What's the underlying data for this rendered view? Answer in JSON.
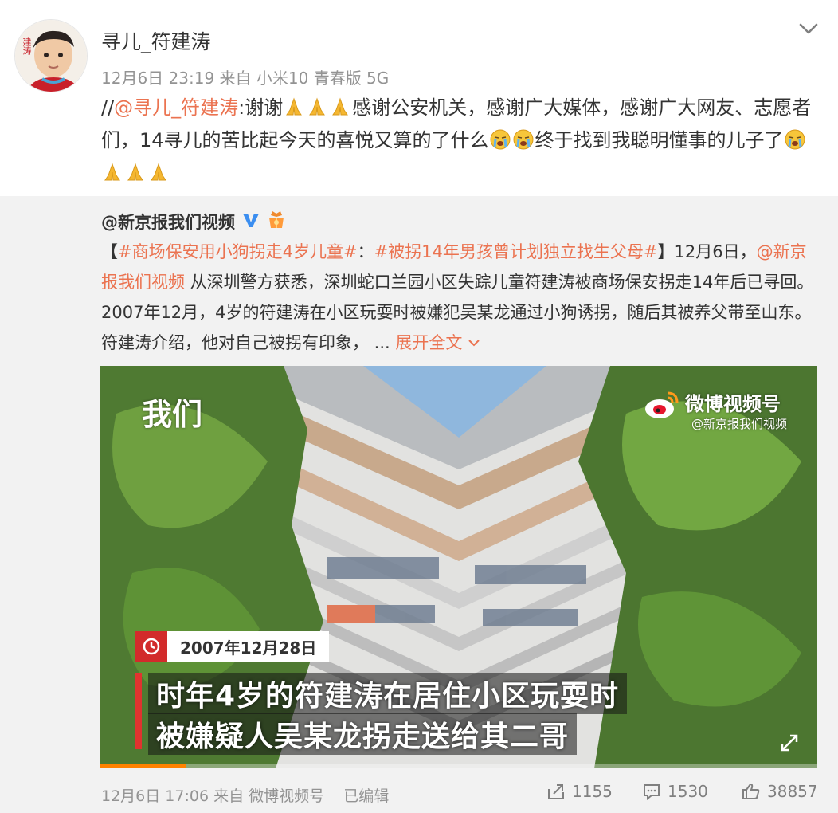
{
  "post": {
    "author": "寻儿_符建涛",
    "time": "12月6日 23:19",
    "source_prefix": "来自",
    "source": "小米10 青春版 5G",
    "text_prefix": "//",
    "mention": "@寻儿_符建涛",
    "text_colon": ":",
    "text_1": "谢谢",
    "text_2": "感谢公安机关，感谢广大媒体，感谢广大网友、志愿者们，14寻儿的苦比起今天的喜悦又算的了什么",
    "text_3": "终于找到我聪明懂事的儿子了",
    "avatar_text": "建涛"
  },
  "repost": {
    "author": "@新京报我们视频",
    "tag_open": "【",
    "hashtag_1": "#商场保安用小狗拐走4岁儿童#",
    "hashtag_sep": "：",
    "hashtag_2": "#被拐14年男孩曾计划独立找生父母#",
    "tag_close": "】",
    "date_text": "12月6日，",
    "mention": "@新京报我们视频",
    "body_1": " 从深圳警方获悉，深圳蛇口兰园小区失踪儿童符建涛被商场保安拐走14年后已寻回。2007年12月，4岁的符建涛在小区玩耍时被嫌犯吴某龙通过小狗诱拐，随后其被养父带至山东。符建涛介绍，他对自己被拐有印象，",
    "ellipsis": " ... ",
    "expand": "展开全文",
    "video": {
      "watermark_left": "我们",
      "watermark_right_title": "微博视频号",
      "watermark_right_sub": "@新京报我们视频",
      "caption_date": "2007年12月28日",
      "caption_line_1": "时年4岁的符建涛在居住小区玩耍时",
      "caption_line_2": "被嫌疑人吴某龙拐走送给其二哥",
      "progress": 0.12
    },
    "footer": {
      "time": "12月6日 17:06",
      "source_prefix": "来自",
      "source": "微博视频号",
      "edited": "已编辑",
      "reposts": "1155",
      "comments": "1530",
      "likes": "38857"
    }
  },
  "colors": {
    "link": "#eb7350",
    "repost_bg": "#f2f2f2",
    "meta": "#939393",
    "verified": "#3b8ef0"
  },
  "icons": [
    "chevron-down-icon",
    "pray-emoji",
    "crying-emoji",
    "verified-icon",
    "gift-icon",
    "clock-icon",
    "weibo-logo-icon",
    "fullscreen-icon",
    "repost-icon",
    "comment-icon",
    "like-icon"
  ]
}
